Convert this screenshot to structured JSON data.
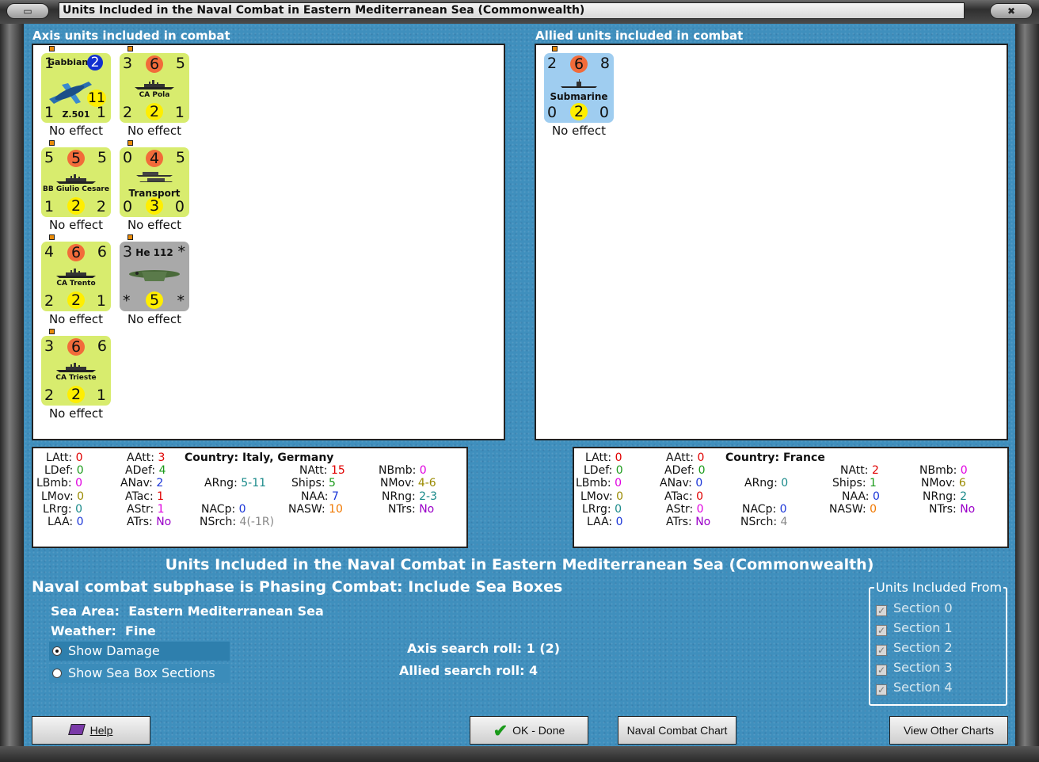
{
  "window": {
    "title": "Units Included in the Naval Combat in Eastern Mediterranean Sea (Commonwealth)",
    "left_btn": "▭",
    "right_btn": "✖"
  },
  "axis": {
    "label": "Axis units included in combat",
    "units": [
      {
        "name": "Gabbiano",
        "model": "Z.501",
        "tl": "1",
        "tc": "2",
        "tr": "",
        "bl": "1",
        "bc": "11",
        "br": "1",
        "color": "#d8ec6e",
        "effect": "No effect",
        "kind": "seaplane"
      },
      {
        "name": "CA Pola",
        "tl": "3",
        "tc": "6",
        "tr": "5",
        "bl": "2",
        "bc": "2",
        "br": "1",
        "color": "#d8ec6e",
        "effect": "No effect",
        "kind": "ship"
      },
      {
        "name": "BB Giulio Cesare",
        "tl": "5",
        "tc": "5",
        "tr": "5",
        "bl": "1",
        "bc": "2",
        "br": "2",
        "color": "#d8ec6e",
        "effect": "No effect",
        "kind": "ship"
      },
      {
        "name": "Transport",
        "tl": "0",
        "tc": "4",
        "tr": "5",
        "bl": "0",
        "bc": "3",
        "br": "0",
        "color": "#d8ec6e",
        "effect": "No effect",
        "kind": "transport"
      },
      {
        "name": "CA Trento",
        "tl": "4",
        "tc": "6",
        "tr": "6",
        "bl": "2",
        "bc": "2",
        "br": "1",
        "color": "#d8ec6e",
        "effect": "No effect",
        "kind": "ship"
      },
      {
        "name": "He 112",
        "tl": "3",
        "tc": "",
        "tr": "*",
        "bl": "*",
        "bc": "5",
        "br": "*",
        "color": "#a9a9a9",
        "effect": "No effect",
        "kind": "plane"
      },
      {
        "name": "CA Trieste",
        "tl": "3",
        "tc": "6",
        "tr": "6",
        "bl": "2",
        "bc": "2",
        "br": "1",
        "color": "#d8ec6e",
        "effect": "No effect",
        "kind": "ship"
      }
    ],
    "stats": {
      "country_label": "Country:",
      "country": "Italy, Germany",
      "LAtt": "0",
      "LDef": "0",
      "LBmb": "0",
      "LMov": "0",
      "LRrg": "0",
      "LAA": "0",
      "AAtt": "3",
      "ADef": "4",
      "ANav": "2",
      "ATac": "1",
      "AStr": "1",
      "ATrs": "No",
      "ARng": "5-11",
      "NACp": "0",
      "NSrch": "4(-1R)",
      "NAtt": "15",
      "Ships": "5",
      "NAA": "7",
      "NASW": "10",
      "NBmb": "0",
      "NMov": "4-6",
      "NRng": "2-3",
      "NTrs": "No"
    }
  },
  "allied": {
    "label": "Allied units included in combat",
    "units": [
      {
        "name": "Submarine",
        "tl": "2",
        "tc": "6",
        "tr": "8",
        "bl": "0",
        "bc": "2",
        "br": "0",
        "color": "#9fcdf0",
        "effect": "No effect",
        "kind": "sub"
      }
    ],
    "stats": {
      "country_label": "Country:",
      "country": "France",
      "LAtt": "0",
      "LDef": "0",
      "LBmb": "0",
      "LMov": "0",
      "LRrg": "0",
      "LAA": "0",
      "AAtt": "0",
      "ADef": "0",
      "ANav": "0",
      "ATac": "0",
      "AStr": "0",
      "ATrs": "No",
      "ARng": "0",
      "NACp": "0",
      "NSrch": "4",
      "NAtt": "2",
      "Ships": "1",
      "NAA": "0",
      "NASW": "0",
      "NBmb": "0",
      "NMov": "6",
      "NRng": "2",
      "NTrs": "No"
    }
  },
  "summary": {
    "title": "Units Included in the Naval Combat in Eastern Mediterranean Sea (Commonwealth)",
    "subphase": "Naval combat subphase is Phasing Combat: Include Sea Boxes",
    "sea_area_label": "Sea Area:",
    "sea_area": "Eastern Mediterranean Sea",
    "weather_label": "Weather:",
    "weather": "Fine",
    "axis_roll_label": "Axis search roll:",
    "axis_roll": "1 (2)",
    "allied_roll_label": "Allied search roll:",
    "allied_roll": "4"
  },
  "options": {
    "show_damage": "Show Damage",
    "show_sections": "Show Sea Box Sections"
  },
  "sections": {
    "title": "Units Included From",
    "items": [
      "Section 0",
      "Section 1",
      "Section 2",
      "Section 3",
      "Section 4"
    ]
  },
  "buttons": {
    "help": "Help",
    "ok": "OK - Done",
    "chart": "Naval Combat Chart",
    "other": "View Other Charts"
  }
}
